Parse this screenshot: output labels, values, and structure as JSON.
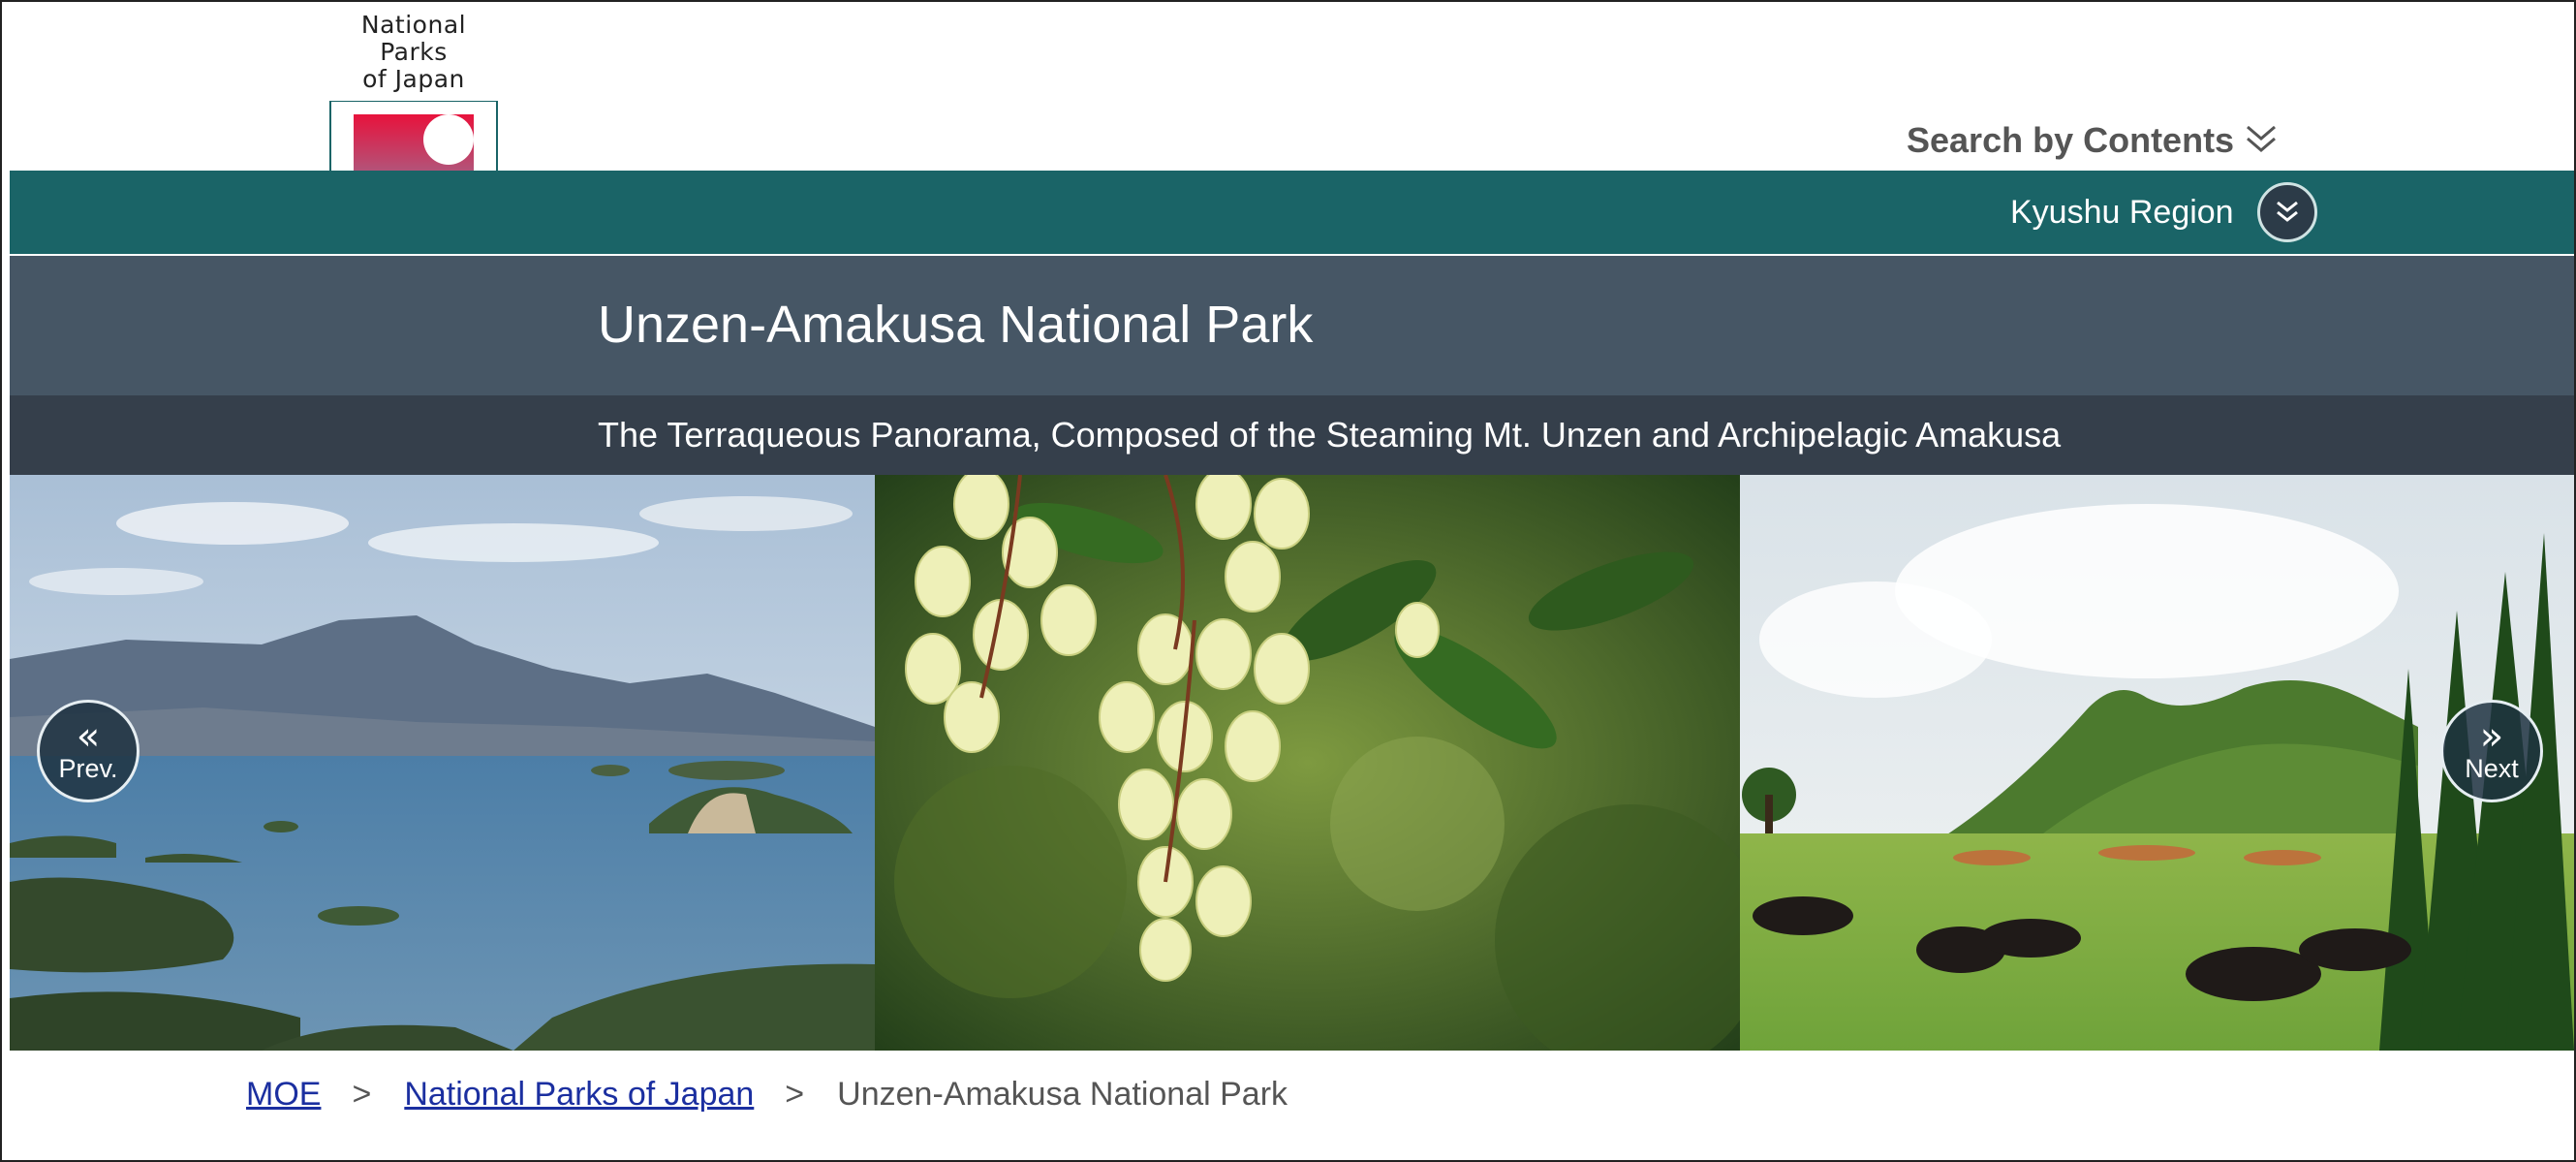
{
  "logo": {
    "text": "National\nParks\nof Japan",
    "accent_top": "#e8123c",
    "accent_bottom": "#5a86c8"
  },
  "header": {
    "search_label": "Search by Contents",
    "region_label": "Kyushu Region"
  },
  "park": {
    "title": "Unzen-Amakusa National Park",
    "subtitle": "The Terraqueous Panorama, Composed of the Steaming Mt. Unzen and Archipelagic Amakusa"
  },
  "slider": {
    "prev_label": "Prev.",
    "next_label": "Next",
    "slides": [
      "coastal-islands-photo",
      "white-bell-flowers-photo",
      "grazing-cattle-mountain-photo"
    ]
  },
  "breadcrumb": {
    "items": [
      "MOE",
      "National Parks of Japan",
      "Unzen-Amakusa National Park"
    ],
    "separator": ">"
  },
  "colors": {
    "teal": "#1a6467",
    "title_band": "#465665",
    "subtitle_band": "#353f4b",
    "link": "#1b2fa0"
  }
}
